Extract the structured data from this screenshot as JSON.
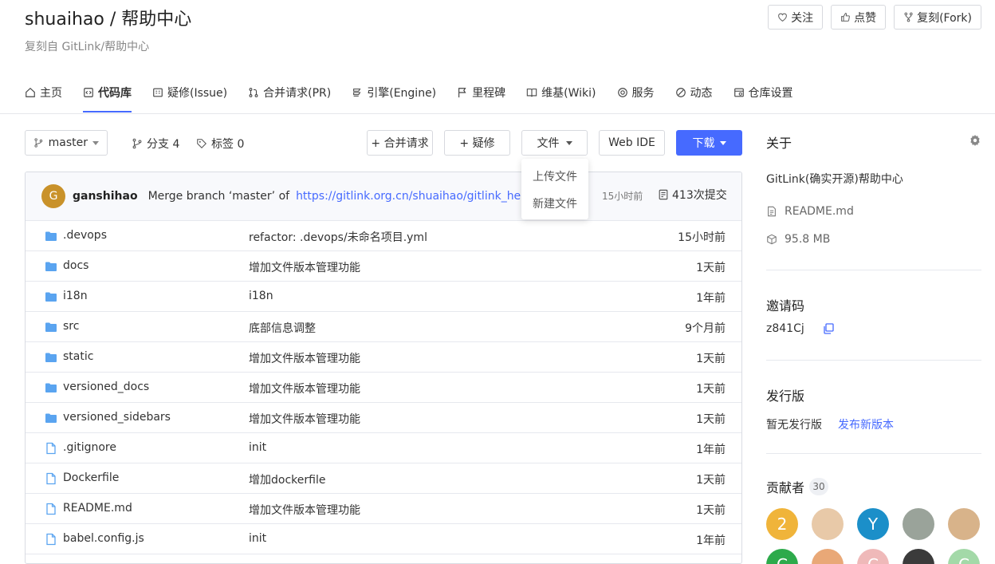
{
  "repo": {
    "title": "shuaihao / 帮助中心",
    "forked_from": "复刻自 GitLink/帮助中心"
  },
  "top_actions": {
    "follow": "关注",
    "like": "点赞",
    "fork": "复刻(Fork)"
  },
  "tabs": [
    {
      "label": "主页",
      "icon": "home-icon"
    },
    {
      "label": "代码库",
      "icon": "code-icon",
      "active": true
    },
    {
      "label": "疑修(Issue)",
      "icon": "issue-icon"
    },
    {
      "label": "合并请求(PR)",
      "icon": "pull-request-icon"
    },
    {
      "label": "引擎(Engine)",
      "icon": "engine-icon"
    },
    {
      "label": "里程碑",
      "icon": "milestone-flag-icon"
    },
    {
      "label": "维基(Wiki)",
      "icon": "book-icon"
    },
    {
      "label": "服务",
      "icon": "service-icon"
    },
    {
      "label": "动态",
      "icon": "activity-icon"
    },
    {
      "label": "仓库设置",
      "icon": "settings-icon"
    }
  ],
  "toolbar": {
    "branch": "master",
    "branches_label": "分支 4",
    "tags_label": "标签 0",
    "merge_request": "+ 合并请求",
    "issue": "+ 疑修",
    "file": "文件",
    "web_ide": "Web IDE",
    "download": "下载"
  },
  "file_menu": {
    "upload": "上传文件",
    "new_file": "新建文件"
  },
  "commit": {
    "avatar_letter": "G",
    "author": "ganshihao",
    "message": "Merge branch ‘master’  of",
    "link": "https://gitlink.org.cn/shuaihao/gitlink_help_center",
    "time": "15小时前",
    "count": "413次提交"
  },
  "files": [
    {
      "name": ".devops",
      "type": "folder",
      "message": "refactor: .devops/未命名项目.yml",
      "time": "15小时前"
    },
    {
      "name": "docs",
      "type": "folder",
      "message": "增加文件版本管理功能",
      "time": "1天前"
    },
    {
      "name": "i18n",
      "type": "folder",
      "message": "i18n",
      "time": "1年前"
    },
    {
      "name": "src",
      "type": "folder",
      "message": "底部信息调整",
      "time": "9个月前"
    },
    {
      "name": "static",
      "type": "folder",
      "message": "增加文件版本管理功能",
      "time": "1天前"
    },
    {
      "name": "versioned_docs",
      "type": "folder",
      "message": "增加文件版本管理功能",
      "time": "1天前"
    },
    {
      "name": "versioned_sidebars",
      "type": "folder",
      "message": "增加文件版本管理功能",
      "time": "1天前"
    },
    {
      "name": ".gitignore",
      "type": "file",
      "message": "init",
      "time": "1年前"
    },
    {
      "name": "Dockerfile",
      "type": "file",
      "message": "增加dockerfile",
      "time": "1天前"
    },
    {
      "name": "README.md",
      "type": "file",
      "message": "增加文件版本管理功能",
      "time": "1天前"
    },
    {
      "name": "babel.config.js",
      "type": "file",
      "message": "init",
      "time": "1年前"
    }
  ],
  "about": {
    "title": "关于",
    "description": "GitLink(确实开源)帮助中心",
    "readme": "README.md",
    "size": "95.8 MB"
  },
  "invite": {
    "title": "邀请码",
    "code": "z841Cj"
  },
  "release": {
    "title": "发行版",
    "none": "暂无发行版",
    "publish": "发布新版本"
  },
  "contributors": {
    "title": "贡献者",
    "count": "30",
    "avatars": [
      {
        "label": "2",
        "color": "#f0b43a"
      },
      {
        "label": "",
        "color": "#e8c9a8"
      },
      {
        "label": "Y",
        "color": "#1b8fc9"
      },
      {
        "label": "",
        "color": "#9aa39a"
      },
      {
        "label": "",
        "color": "#d8b38a"
      },
      {
        "label": "C",
        "color": "#2daa4b"
      },
      {
        "label": "",
        "color": "#e9a877"
      },
      {
        "label": "C",
        "color": "#efb9b9"
      },
      {
        "label": "",
        "color": "#3b3b3b"
      },
      {
        "label": "C",
        "color": "#a3d9a8"
      }
    ]
  },
  "colors": {
    "accent": "#466aff",
    "folder": "#5aa4f0",
    "file_icon": "#5aa4f0"
  }
}
